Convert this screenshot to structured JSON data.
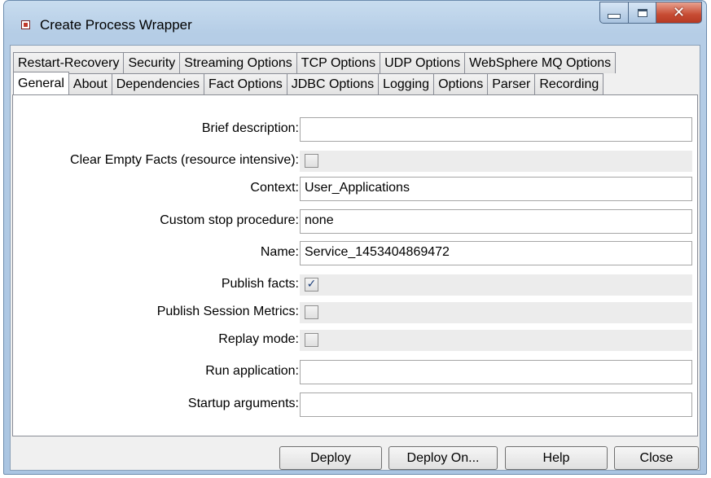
{
  "window": {
    "title": "Create Process Wrapper",
    "controls": {
      "minimize": "minimize-icon",
      "maximize": "maximize-icon",
      "close": "close-icon"
    }
  },
  "tabs": {
    "row1": [
      "Restart-Recovery",
      "Security",
      "Streaming Options",
      "TCP Options",
      "UDP Options",
      "WebSphere MQ Options"
    ],
    "row2": [
      "General",
      "About",
      "Dependencies",
      "Fact Options",
      "JDBC Options",
      "Logging",
      "Options",
      "Parser",
      "Recording"
    ],
    "active": "General"
  },
  "form": {
    "brief_description": {
      "label": "Brief description:",
      "value": ""
    },
    "clear_empty_facts": {
      "label": "Clear Empty Facts (resource intensive):",
      "checked": false
    },
    "context": {
      "label": "Context:",
      "value": "User_Applications"
    },
    "custom_stop_procedure": {
      "label": "Custom stop procedure:",
      "value": "none"
    },
    "name": {
      "label": "Name:",
      "value": "Service_1453404869472"
    },
    "publish_facts": {
      "label": "Publish facts:",
      "checked": true,
      "mark": "✓"
    },
    "publish_session_metrics": {
      "label": "Publish Session Metrics:",
      "checked": false
    },
    "replay_mode": {
      "label": "Replay mode:",
      "checked": false
    },
    "run_application": {
      "label": "Run application:",
      "value": ""
    },
    "startup_arguments": {
      "label": "Startup arguments:",
      "value": ""
    }
  },
  "buttons": {
    "deploy": "Deploy",
    "deploy_on": "Deploy On...",
    "help": "Help",
    "close": "Close"
  }
}
